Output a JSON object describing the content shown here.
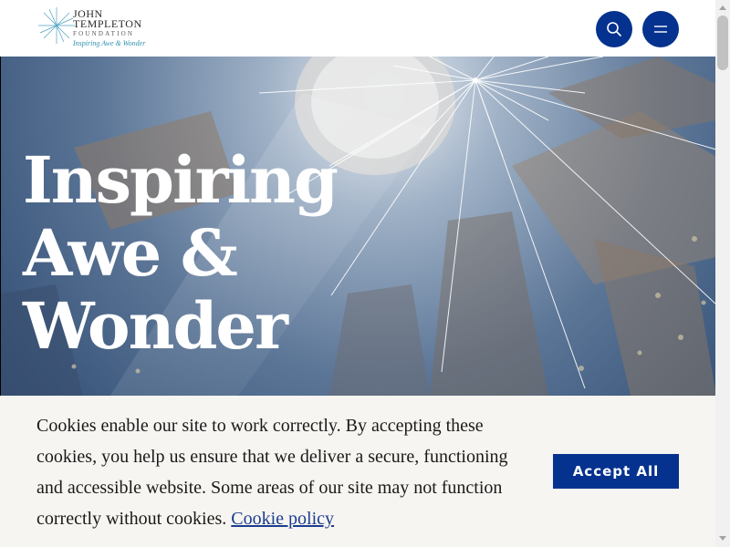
{
  "header": {
    "logo": {
      "line1": "JOHN",
      "line2": "TEMPLETON",
      "line3": "FOUNDATION",
      "tagline": "Inspiring Awe & Wonder"
    },
    "search_icon": "search-icon",
    "menu_icon": "hamburger-menu-icon",
    "accent_color": "#05328f"
  },
  "hero": {
    "title_lines": [
      "Inspiring",
      "Awe &",
      "Wonder"
    ]
  },
  "cookie_banner": {
    "text": "Cookies enable our site to work correctly. By accepting these cookies, you help us ensure that we deliver a secure, functioning and accessible website. Some areas of our site may not function correctly without cookies.",
    "link_label": "Cookie policy",
    "accept_label": "Accept All"
  }
}
